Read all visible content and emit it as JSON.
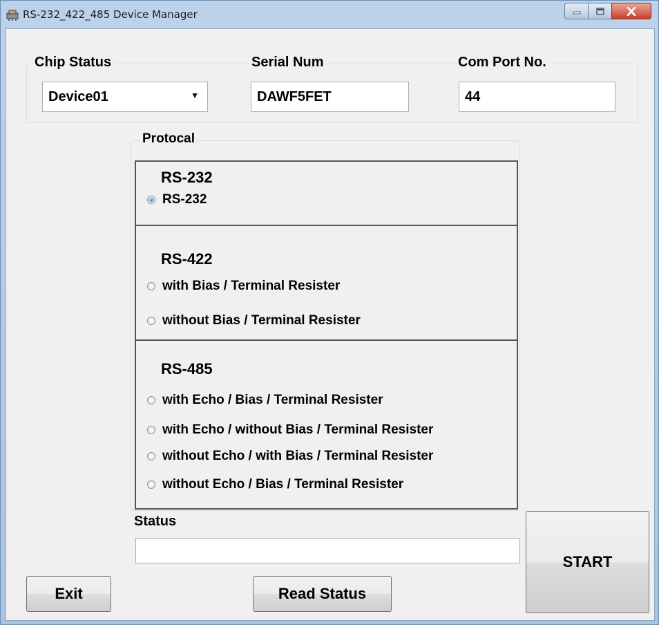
{
  "window": {
    "title": "RS-232_422_485 Device Manager"
  },
  "header": {
    "chip_status_label": "Chip Status",
    "chip_status_value": "Device01",
    "serial_label": "Serial Num",
    "serial_value": "DAWF5FET",
    "com_port_label": "Com Port No.",
    "com_port_value": "44"
  },
  "protocol": {
    "group_label": "Protocal",
    "rs232": {
      "title": "RS-232",
      "options": [
        {
          "label": "RS-232",
          "checked": true
        }
      ]
    },
    "rs422": {
      "title": "RS-422",
      "options": [
        {
          "label": "with Bias / Terminal Resister",
          "checked": false
        },
        {
          "label": "without Bias / Terminal Resister",
          "checked": false
        }
      ]
    },
    "rs485": {
      "title": "RS-485",
      "options": [
        {
          "label": "with Echo / Bias / Terminal Resister",
          "checked": false
        },
        {
          "label": "with Echo / without Bias / Terminal Resister",
          "checked": false
        },
        {
          "label": "without Echo / with Bias / Terminal Resister",
          "checked": false
        },
        {
          "label": "without Echo / Bias / Terminal Resister",
          "checked": false
        }
      ]
    }
  },
  "status": {
    "label": "Status",
    "value": ""
  },
  "buttons": {
    "exit": "Exit",
    "read_status": "Read Status",
    "start": "START"
  }
}
